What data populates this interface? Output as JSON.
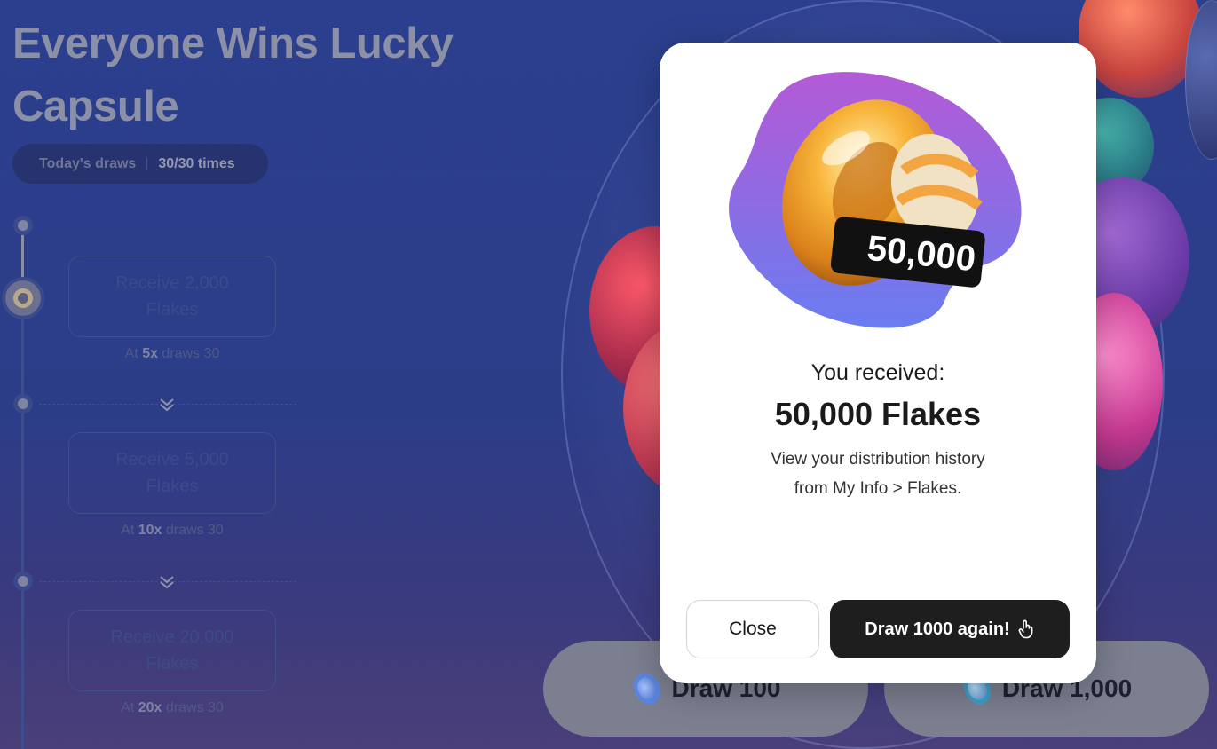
{
  "page": {
    "title": "Everyone Wins Lucky Capsule",
    "draws_label": "Today's draws",
    "draws_count": "30/30 times"
  },
  "milestones": [
    {
      "reward": "Receive 2,000 Flakes",
      "caption_prefix": "At ",
      "multiplier": "5x",
      "caption_suffix": " draws 30"
    },
    {
      "reward": "Receive 5,000 Flakes",
      "caption_prefix": "At ",
      "multiplier": "10x",
      "caption_suffix": " draws 30"
    },
    {
      "reward": "Receive 20,000 Flakes",
      "caption_prefix": "At ",
      "multiplier": "20x",
      "caption_suffix": " draws 30"
    }
  ],
  "draw_buttons": {
    "draw_100": "Draw 100",
    "draw_1000": "Draw 1,000"
  },
  "modal": {
    "badge": "50,000",
    "received_label": "You received:",
    "amount": "50,000 Flakes",
    "hint_line1": "View your distribution history",
    "hint_line2": "from My Info > Flakes.",
    "close_label": "Close",
    "again_label": "Draw 1000 again!"
  },
  "icons": {
    "again_button_icon": "hand-pointer-icon",
    "draw_button_icon": "capsule-ring-icon"
  },
  "colors": {
    "accent_dark": "#1e1e1e",
    "background": "#2b3f8e",
    "blob_top": "#b45ad6",
    "blob_bottom": "#6a7cf0"
  }
}
